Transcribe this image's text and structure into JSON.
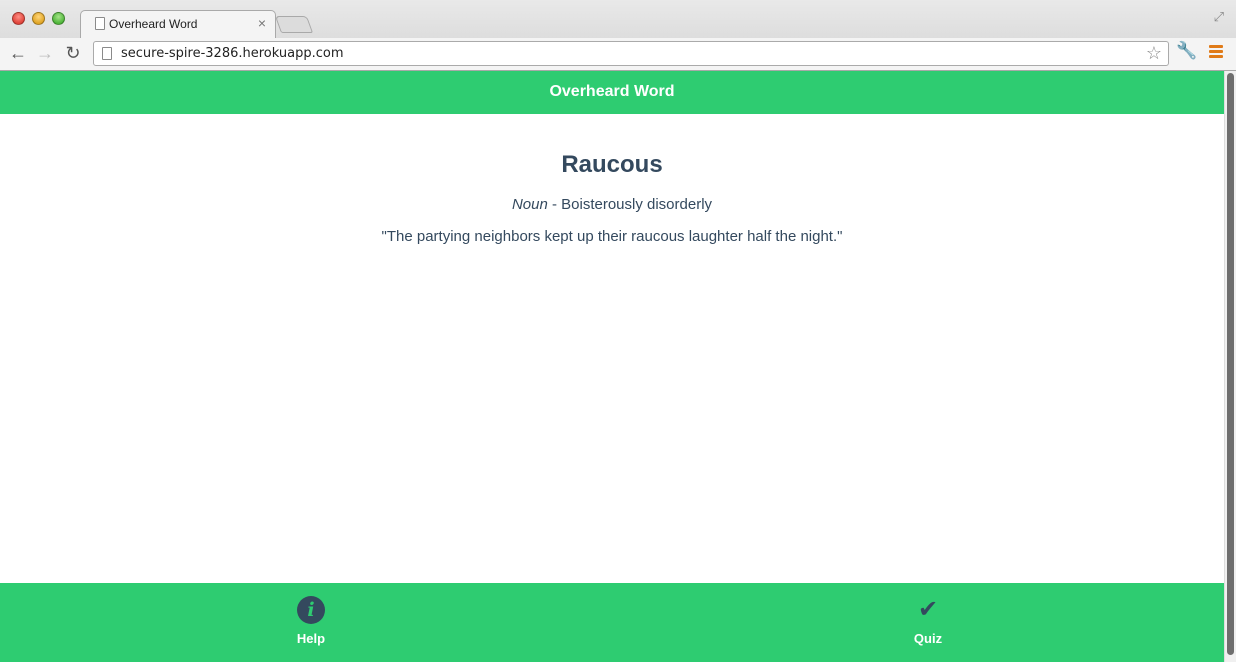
{
  "browser": {
    "tab_title": "Overheard Word",
    "tab_close": "×",
    "url": "secure-spire-3286.herokuapp.com",
    "back": "←",
    "forward": "→",
    "reload": "↻",
    "star": "☆",
    "wrench": "🔧",
    "fullscreen": "⤢"
  },
  "app": {
    "title": "Overheard Word",
    "accent_color": "#2ecc71",
    "text_color": "#34495e"
  },
  "word": {
    "term": "Raucous",
    "part_of_speech": "Noun",
    "separator": " - ",
    "definition": "Boisterously disorderly",
    "example": "\"The partying neighbors kept up their raucous laughter half the night.\""
  },
  "footer": {
    "help": {
      "icon": "i",
      "label": "Help"
    },
    "quiz": {
      "icon": "✔",
      "label": "Quiz"
    }
  }
}
